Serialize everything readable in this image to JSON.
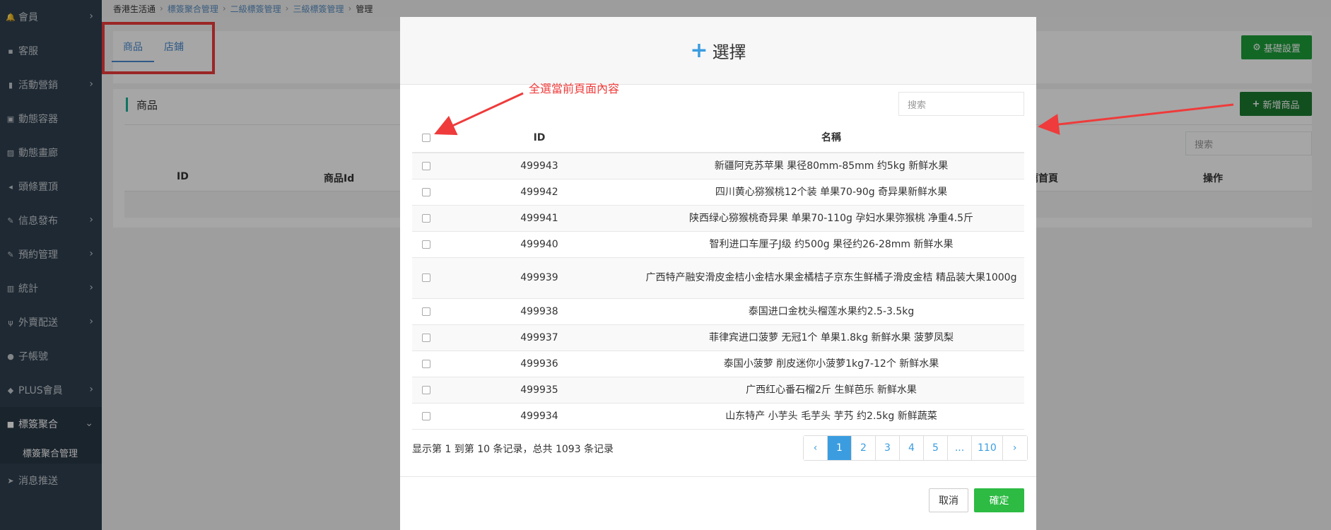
{
  "breadcrumb": [
    "香港生活通",
    "標簽聚合管理",
    "二級標簽管理",
    "三級標簽管理",
    "管理"
  ],
  "sidebar": {
    "items": [
      {
        "label": "會員",
        "icon": "bell-icon",
        "glyph": "🔔",
        "chevron": true
      },
      {
        "label": "客服",
        "icon": "chat-icon",
        "glyph": "▪",
        "chevron": false
      },
      {
        "label": "活動營銷",
        "icon": "bookmark-icon",
        "glyph": "▮",
        "chevron": true
      },
      {
        "label": "動態容器",
        "icon": "inbox-icon",
        "glyph": "▣",
        "chevron": false
      },
      {
        "label": "動態畫廊",
        "icon": "image-icon",
        "glyph": "▨",
        "chevron": false
      },
      {
        "label": "頭條置頂",
        "icon": "volume-icon",
        "glyph": "◂",
        "chevron": false
      },
      {
        "label": "信息發布",
        "icon": "edit-icon",
        "glyph": "✎",
        "chevron": true
      },
      {
        "label": "預約管理",
        "icon": "edit-icon",
        "glyph": "✎",
        "chevron": true
      },
      {
        "label": "統計",
        "icon": "bar-chart-icon",
        "glyph": "▥",
        "chevron": true
      },
      {
        "label": "外賣配送",
        "icon": "cutlery-icon",
        "glyph": "ψ",
        "chevron": true
      },
      {
        "label": "子帳號",
        "icon": "user-icon",
        "glyph": "●",
        "chevron": false
      },
      {
        "label": "PLUS會員",
        "icon": "diamond-icon",
        "glyph": "◆",
        "chevron": true
      },
      {
        "label": "標簽聚合",
        "icon": "square-icon",
        "glyph": "■",
        "chevron": true,
        "active": true
      },
      {
        "label": "消息推送",
        "icon": "send-icon",
        "glyph": "➤",
        "chevron": false
      }
    ],
    "sub_item": "標簽聚合管理"
  },
  "tabs": {
    "goods": "商品",
    "shop": "店鋪"
  },
  "base_settings_label": "基礎設置",
  "list": {
    "title": "商品",
    "add_label": "新增商品",
    "search_placeholder": "搜索",
    "columns": [
      "ID",
      "商品Id",
      "薦首頁",
      "操作"
    ]
  },
  "annotation": "全選當前頁面內容",
  "modal": {
    "title": "選擇",
    "search_placeholder": "搜索",
    "col_id": "ID",
    "col_name": "名稱",
    "rows": [
      {
        "id": "499943",
        "name": "新疆阿克苏苹果 果径80mm-85mm 约5kg 新鲜水果"
      },
      {
        "id": "499942",
        "name": "四川黄心猕猴桃12个装 单果70-90g 奇异果新鲜水果"
      },
      {
        "id": "499941",
        "name": "陕西绿心猕猴桃奇异果 单果70-110g 孕妇水果弥猴桃 净重4.5斤"
      },
      {
        "id": "499940",
        "name": "智利进口车厘子J级 约500g 果径约26-28mm 新鲜水果"
      },
      {
        "id": "499939",
        "name": "广西特产融安滑皮金桔小金桔水果金橘桔子京东生鲜橘子滑皮金桔 精品装大果1000g"
      },
      {
        "id": "499938",
        "name": "泰国进口金枕头榴莲水果约2.5-3.5kg"
      },
      {
        "id": "499937",
        "name": "菲律宾进口菠萝 无冠1个 单果1.8kg 新鲜水果 菠萝凤梨"
      },
      {
        "id": "499936",
        "name": "泰国小菠萝 削皮迷你小菠萝1kg7-12个 新鲜水果"
      },
      {
        "id": "499935",
        "name": "广西红心番石榴2斤 生鲜芭乐 新鲜水果"
      },
      {
        "id": "499934",
        "name": "山东特产 小芋头 毛芋头 芋艿 约2.5kg 新鲜蔬菜"
      }
    ],
    "pager_info": "显示第 1 到第 10 条记录，总共 1093 条记录",
    "pages": [
      "‹",
      "1",
      "2",
      "3",
      "4",
      "5",
      "...",
      "110",
      "›"
    ],
    "current_page": "1",
    "cancel_label": "取消",
    "confirm_label": "確定"
  }
}
